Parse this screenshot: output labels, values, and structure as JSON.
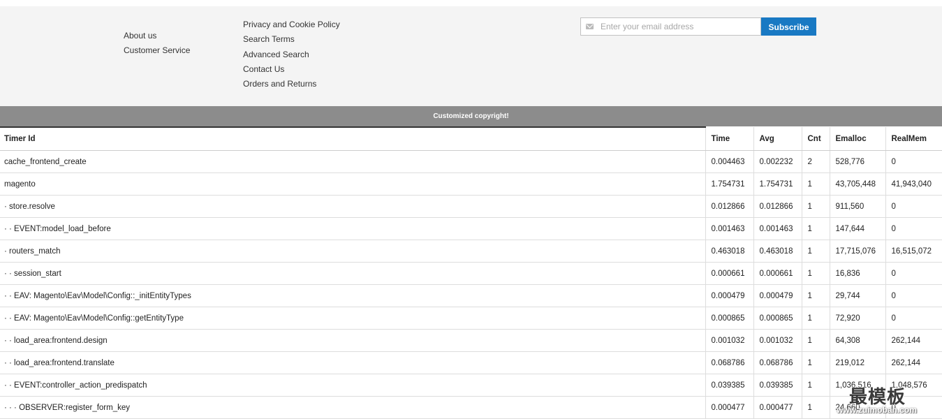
{
  "footer": {
    "links_col1": [
      "About us",
      "Customer Service"
    ],
    "links_col2": [
      "Privacy and Cookie Policy",
      "Search Terms",
      "Advanced Search",
      "Contact Us",
      "Orders and Returns"
    ],
    "newsletter": {
      "placeholder": "Enter your email address",
      "subscribe_label": "Subscribe",
      "icon": "mail-icon"
    }
  },
  "copyright": "Customized copyright!",
  "profiler": {
    "headers": [
      "Timer Id",
      "Time",
      "Avg",
      "Cnt",
      "Emalloc",
      "RealMem"
    ],
    "rows": [
      [
        "cache_frontend_create",
        "0.004463",
        "0.002232",
        "2",
        "528,776",
        "0"
      ],
      [
        "magento",
        "1.754731",
        "1.754731",
        "1",
        "43,705,448",
        "41,943,040"
      ],
      [
        "· store.resolve",
        "0.012866",
        "0.012866",
        "1",
        "911,560",
        "0"
      ],
      [
        "· · EVENT:model_load_before",
        "0.001463",
        "0.001463",
        "1",
        "147,644",
        "0"
      ],
      [
        "· routers_match",
        "0.463018",
        "0.463018",
        "1",
        "17,715,076",
        "16,515,072"
      ],
      [
        "· · session_start",
        "0.000661",
        "0.000661",
        "1",
        "16,836",
        "0"
      ],
      [
        "· · EAV: Magento\\Eav\\Model\\Config::_initEntityTypes",
        "0.000479",
        "0.000479",
        "1",
        "29,744",
        "0"
      ],
      [
        "· · EAV: Magento\\Eav\\Model\\Config::getEntityType",
        "0.000865",
        "0.000865",
        "1",
        "72,920",
        "0"
      ],
      [
        "· · load_area:frontend.design",
        "0.001032",
        "0.001032",
        "1",
        "64,308",
        "262,144"
      ],
      [
        "· · load_area:frontend.translate",
        "0.068786",
        "0.068786",
        "1",
        "219,012",
        "262,144"
      ],
      [
        "· · EVENT:controller_action_predispatch",
        "0.039385",
        "0.039385",
        "1",
        "1,036,516",
        "1,048,576"
      ],
      [
        "· · · OBSERVER:register_form_key",
        "0.000477",
        "0.000477",
        "1",
        "24,660",
        "0"
      ]
    ]
  },
  "watermark": {
    "title": "最模板",
    "url": "www.zuimoban.com"
  }
}
